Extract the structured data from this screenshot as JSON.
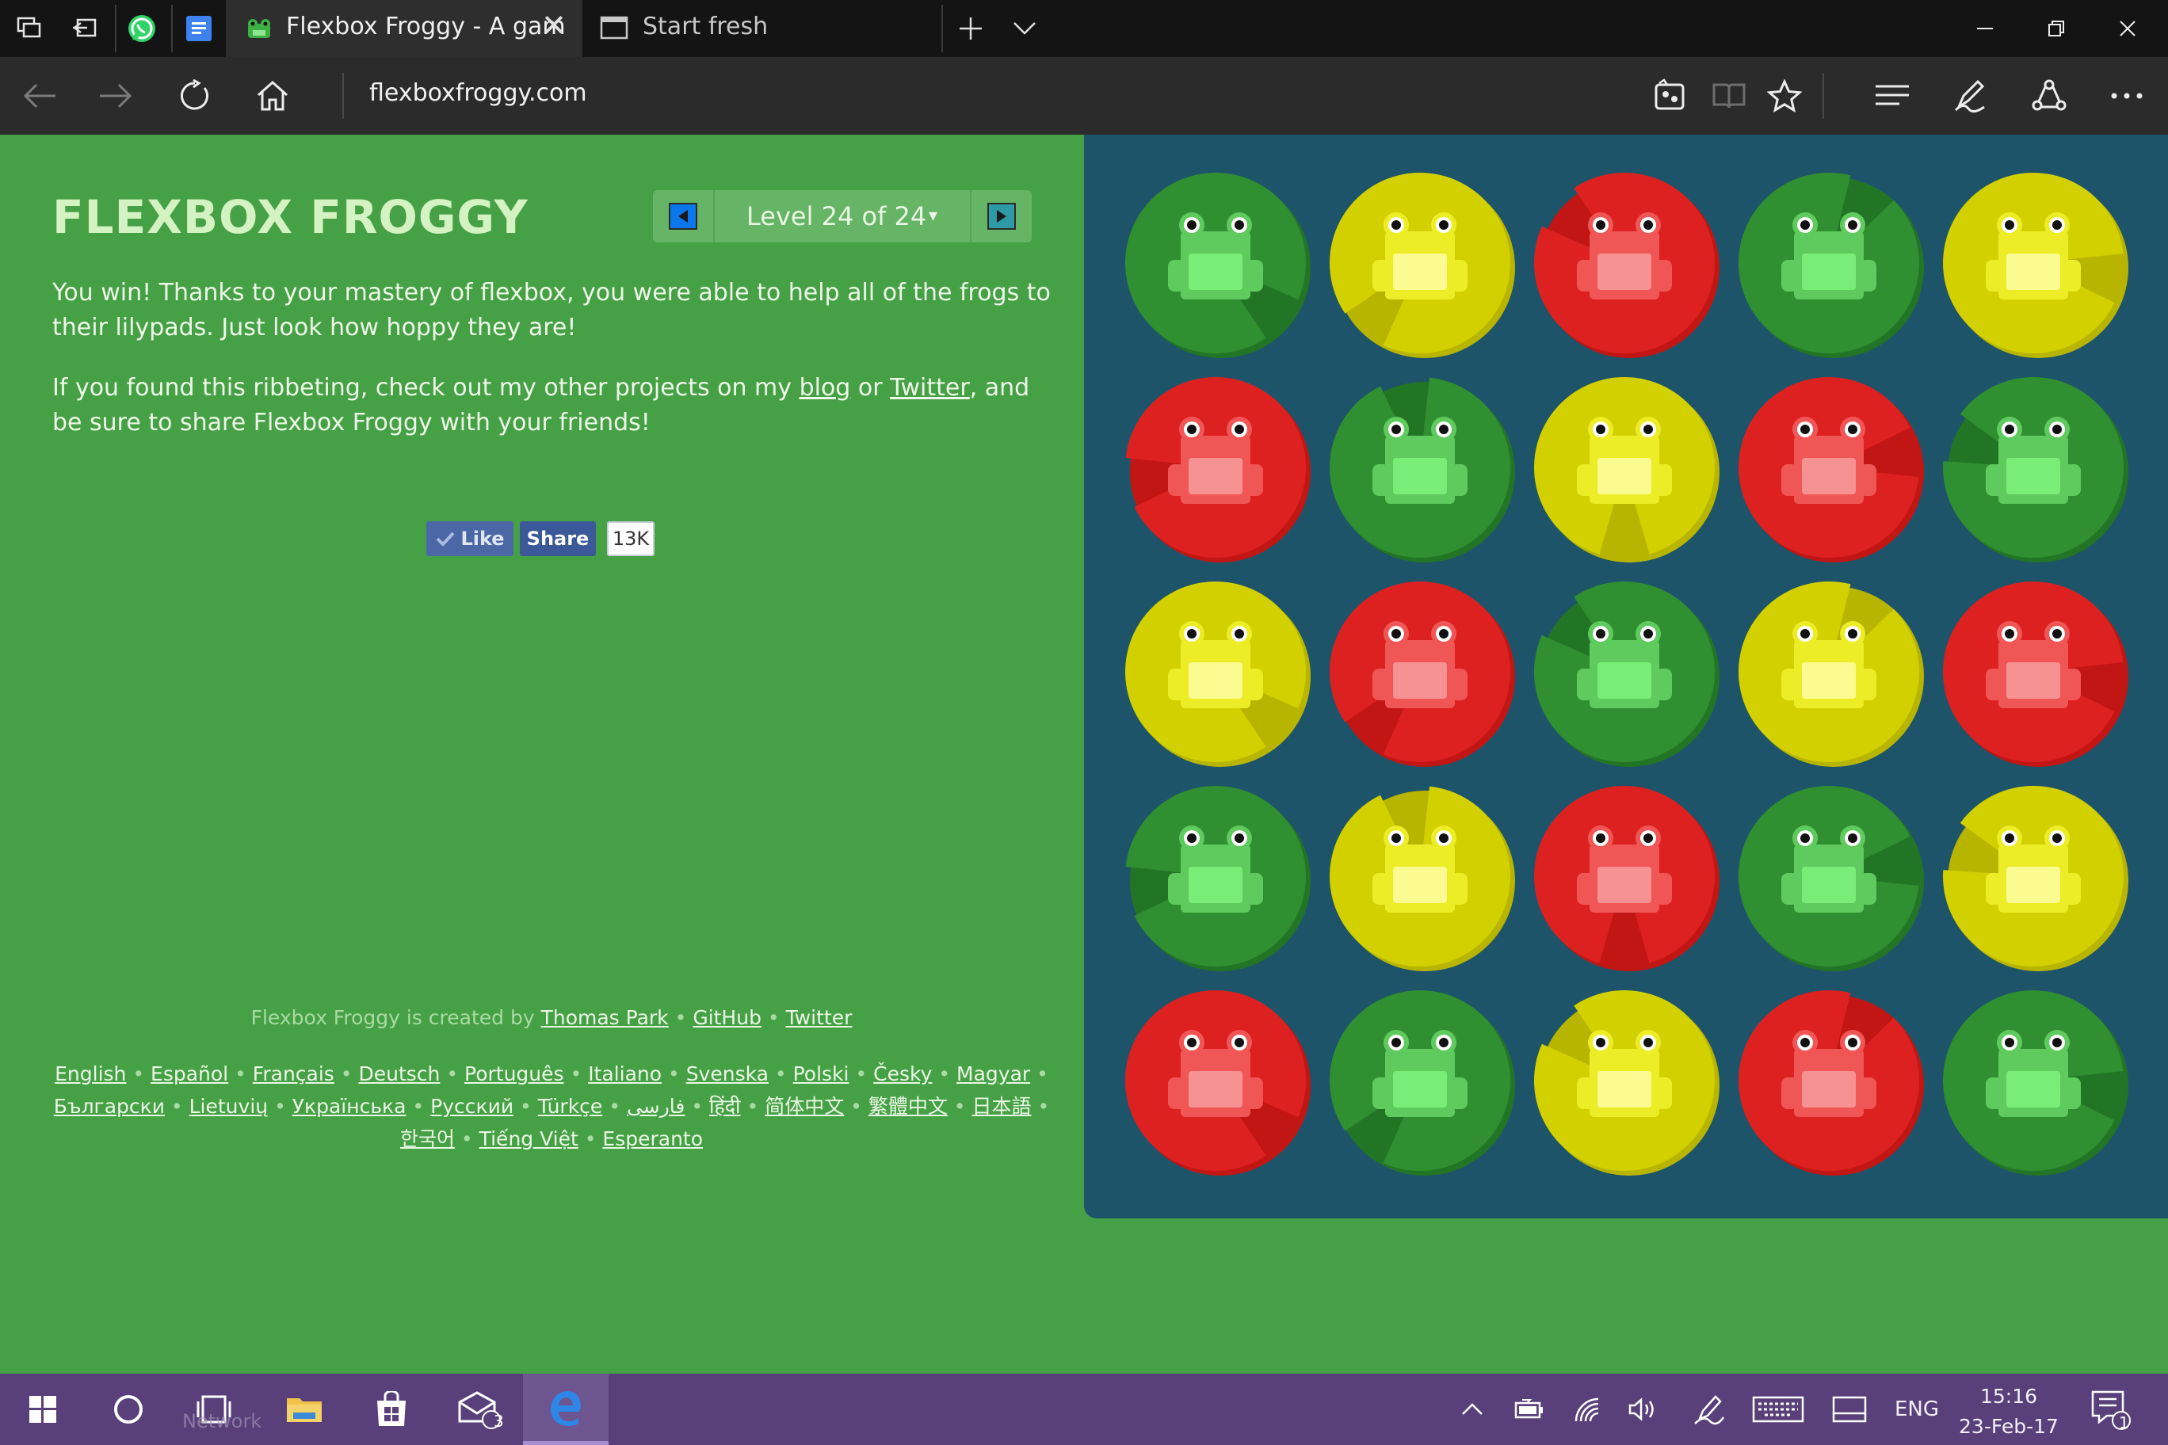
{
  "browser": {
    "tabs": [
      {
        "title": "Flexbox Froggy - A gam",
        "active": true,
        "icon": "frog-favicon-icon"
      },
      {
        "title": "Start fresh",
        "active": false,
        "icon": "new-page-icon"
      }
    ],
    "url": "flexboxfroggy.com",
    "pinned_apps": [
      "tab-preview-icon",
      "set-aside-tabs-icon",
      "whatsapp-icon",
      "google-docs-icon"
    ]
  },
  "page": {
    "brand": "FLEXBOX FROGGY",
    "level_label": "Level 24 of 24",
    "level_caret": "▾",
    "win_text": "You win! Thanks to your mastery of flexbox, you were able to help all of the frogs to their lilypads. Just look how hoppy they are!",
    "share_text": {
      "before": "If you found this ribbeting, check out my other projects on my ",
      "blog": "blog",
      "or": " or ",
      "twitter": "Twitter",
      "after": ", and be sure to share Flexbox Froggy with your friends!"
    },
    "facebook": {
      "like": "Like",
      "share": "Share",
      "count": "13K"
    },
    "credits": {
      "prefix": "Flexbox Froggy is created by ",
      "author": "Thomas Park",
      "github": "GitHub",
      "twitter": "Twitter",
      "bullet": " • "
    },
    "languages": [
      "English",
      "Español",
      "Français",
      "Deutsch",
      "Português",
      "Italiano",
      "Svenska",
      "Polski",
      "Česky",
      "Magyar",
      "Български",
      "Lietuvių",
      "Українська",
      "Русский",
      "Türkçe",
      "فارسی",
      "हिंदी",
      "简体中文",
      "繁體中文",
      "日本語",
      "한국어",
      "Tiếng Việt",
      "Esperanto"
    ]
  },
  "pond": {
    "colors": {
      "green": {
        "pad": "#2f8f31",
        "dark": "#237526",
        "frog": "#5fca5d",
        "belly": "#79ed78"
      },
      "yellow": {
        "pad": "#d3d000",
        "dark": "#b8b500",
        "frog": "#eded27",
        "belly": "#fbfb91"
      },
      "red": {
        "pad": "#dd2120",
        "dark": "#c21614",
        "frog": "#f15656",
        "belly": "#f79292"
      }
    },
    "rows": [
      [
        "green",
        "yellow",
        "red",
        "green",
        "yellow"
      ],
      [
        "red",
        "green",
        "yellow",
        "red",
        "green"
      ],
      [
        "yellow",
        "red",
        "green",
        "yellow",
        "red"
      ],
      [
        "green",
        "yellow",
        "red",
        "green",
        "yellow"
      ],
      [
        "red",
        "green",
        "yellow",
        "red",
        "green"
      ]
    ]
  },
  "taskbar": {
    "time": "15:16",
    "date": "23-Feb-17",
    "language": "ENG",
    "mail_badge": "3",
    "notifications_badge": "1",
    "ghost_label": "Network"
  }
}
